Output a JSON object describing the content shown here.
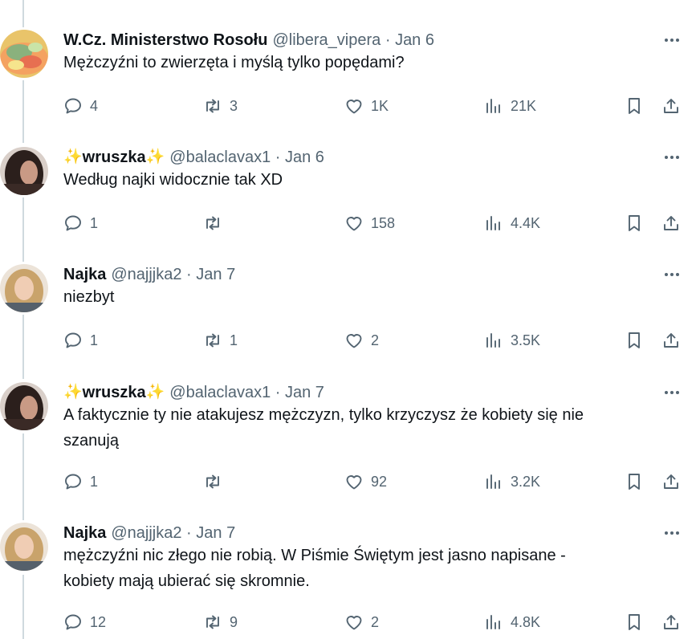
{
  "tweets": [
    {
      "name": "W.Cz. Ministerstwo Rosołu",
      "name_sparkles": false,
      "handle": "@libera_vipera",
      "date": "Jan 6",
      "text": "Mężczyźni to zwierzęta i myślą tylko popędami?",
      "replies": "4",
      "retweets": "3",
      "likes": "1K",
      "views": "21K",
      "avatar": "food-plate"
    },
    {
      "name": "wruszka",
      "name_sparkles": true,
      "handle": "@balaclavax1",
      "date": "Jan 6",
      "text": "Według najki widocznie tak XD",
      "replies": "1",
      "retweets": "",
      "likes": "158",
      "views": "4.4K",
      "avatar": "dark-hair"
    },
    {
      "name": "Najka",
      "name_sparkles": false,
      "handle": "@najjjka2",
      "date": "Jan 7",
      "text": "niezbyt",
      "replies": "1",
      "retweets": "1",
      "likes": "2",
      "views": "3.5K",
      "avatar": "blonde-hair"
    },
    {
      "name": "wruszka",
      "name_sparkles": true,
      "handle": "@balaclavax1",
      "date": "Jan 7",
      "text": "A faktycznie ty nie atakujesz mężczyzn, tylko krzyczysz że kobiety się nie\nszanują",
      "replies": "1",
      "retweets": "",
      "likes": "92",
      "views": "3.2K",
      "avatar": "dark-hair"
    },
    {
      "name": "Najka",
      "name_sparkles": false,
      "handle": "@najjjka2",
      "date": "Jan 7",
      "text": "mężczyźni nic złego nie robią. W Piśmie Świętym jest jasno napisane -\nkobiety mają ubierać się skromnie.",
      "replies": "12",
      "retweets": "9",
      "likes": "2",
      "views": "4.8K",
      "avatar": "blonde-hair"
    }
  ],
  "sparkle_glyph": "✨",
  "colors": {
    "text_primary": "#0f1419",
    "text_secondary": "#536471",
    "thread_line": "#cfd9de",
    "sparkle": "#f5b324"
  }
}
